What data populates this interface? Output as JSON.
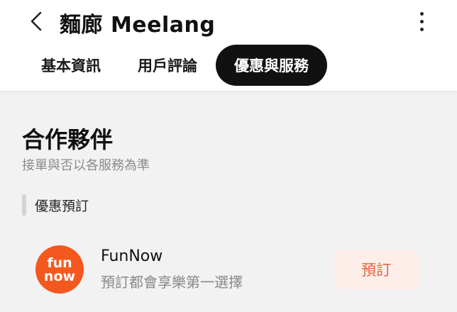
{
  "header": {
    "title": "麵廊 Meelang",
    "back_icon": "chevron-left-icon",
    "more_icon": "more-vertical-icon"
  },
  "tabs": [
    {
      "label": "基本資訊",
      "active": false
    },
    {
      "label": "用戶評論",
      "active": false
    },
    {
      "label": "優惠與服務",
      "active": true
    }
  ],
  "section": {
    "title": "合作夥伴",
    "subtitle": "接單與否以各服務為準"
  },
  "subsection": {
    "label": "優惠預訂"
  },
  "partner": {
    "logo_line1": "fun",
    "logo_line2": "now",
    "logo_color": "#f4581f",
    "name": "FunNow",
    "description": "預訂都會享樂第一選擇",
    "button_label": "預訂",
    "button_color": "#e3653f"
  }
}
